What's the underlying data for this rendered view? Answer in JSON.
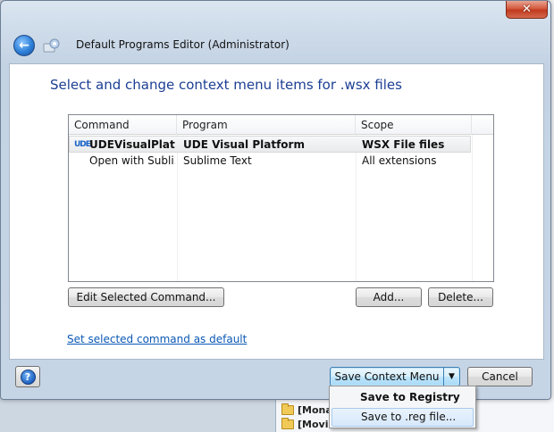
{
  "window": {
    "title": "Default Programs Editor (Administrator)",
    "close_label": "✕"
  },
  "main": {
    "heading": "Select and change context menu items for .wsx files",
    "columns": [
      "Command",
      "Program",
      "Scope"
    ],
    "rows": [
      {
        "icon": "UDE",
        "command": "UDEVisualPlatf...",
        "program": "UDE Visual Platform",
        "scope": "WSX File files",
        "selected": true
      },
      {
        "icon": "",
        "command": "Open with Subli...",
        "program": "Sublime Text",
        "scope": "All extensions",
        "selected": false
      }
    ],
    "edit_button": "Edit Selected Command...",
    "add_button": "Add...",
    "delete_button": "Delete...",
    "default_link": "Set selected command as default"
  },
  "footer": {
    "help_label": "?",
    "save_menu_button": "Save Context Menu",
    "cancel_button": "Cancel"
  },
  "dropdown": {
    "items": [
      "Save to Registry",
      "Save to .reg file..."
    ]
  },
  "background": {
    "folders": [
      "[Mona",
      "[Movin"
    ]
  },
  "colors": {
    "heading": "#1c3f94",
    "link": "#0a58b5",
    "close": "#c03a1d"
  }
}
